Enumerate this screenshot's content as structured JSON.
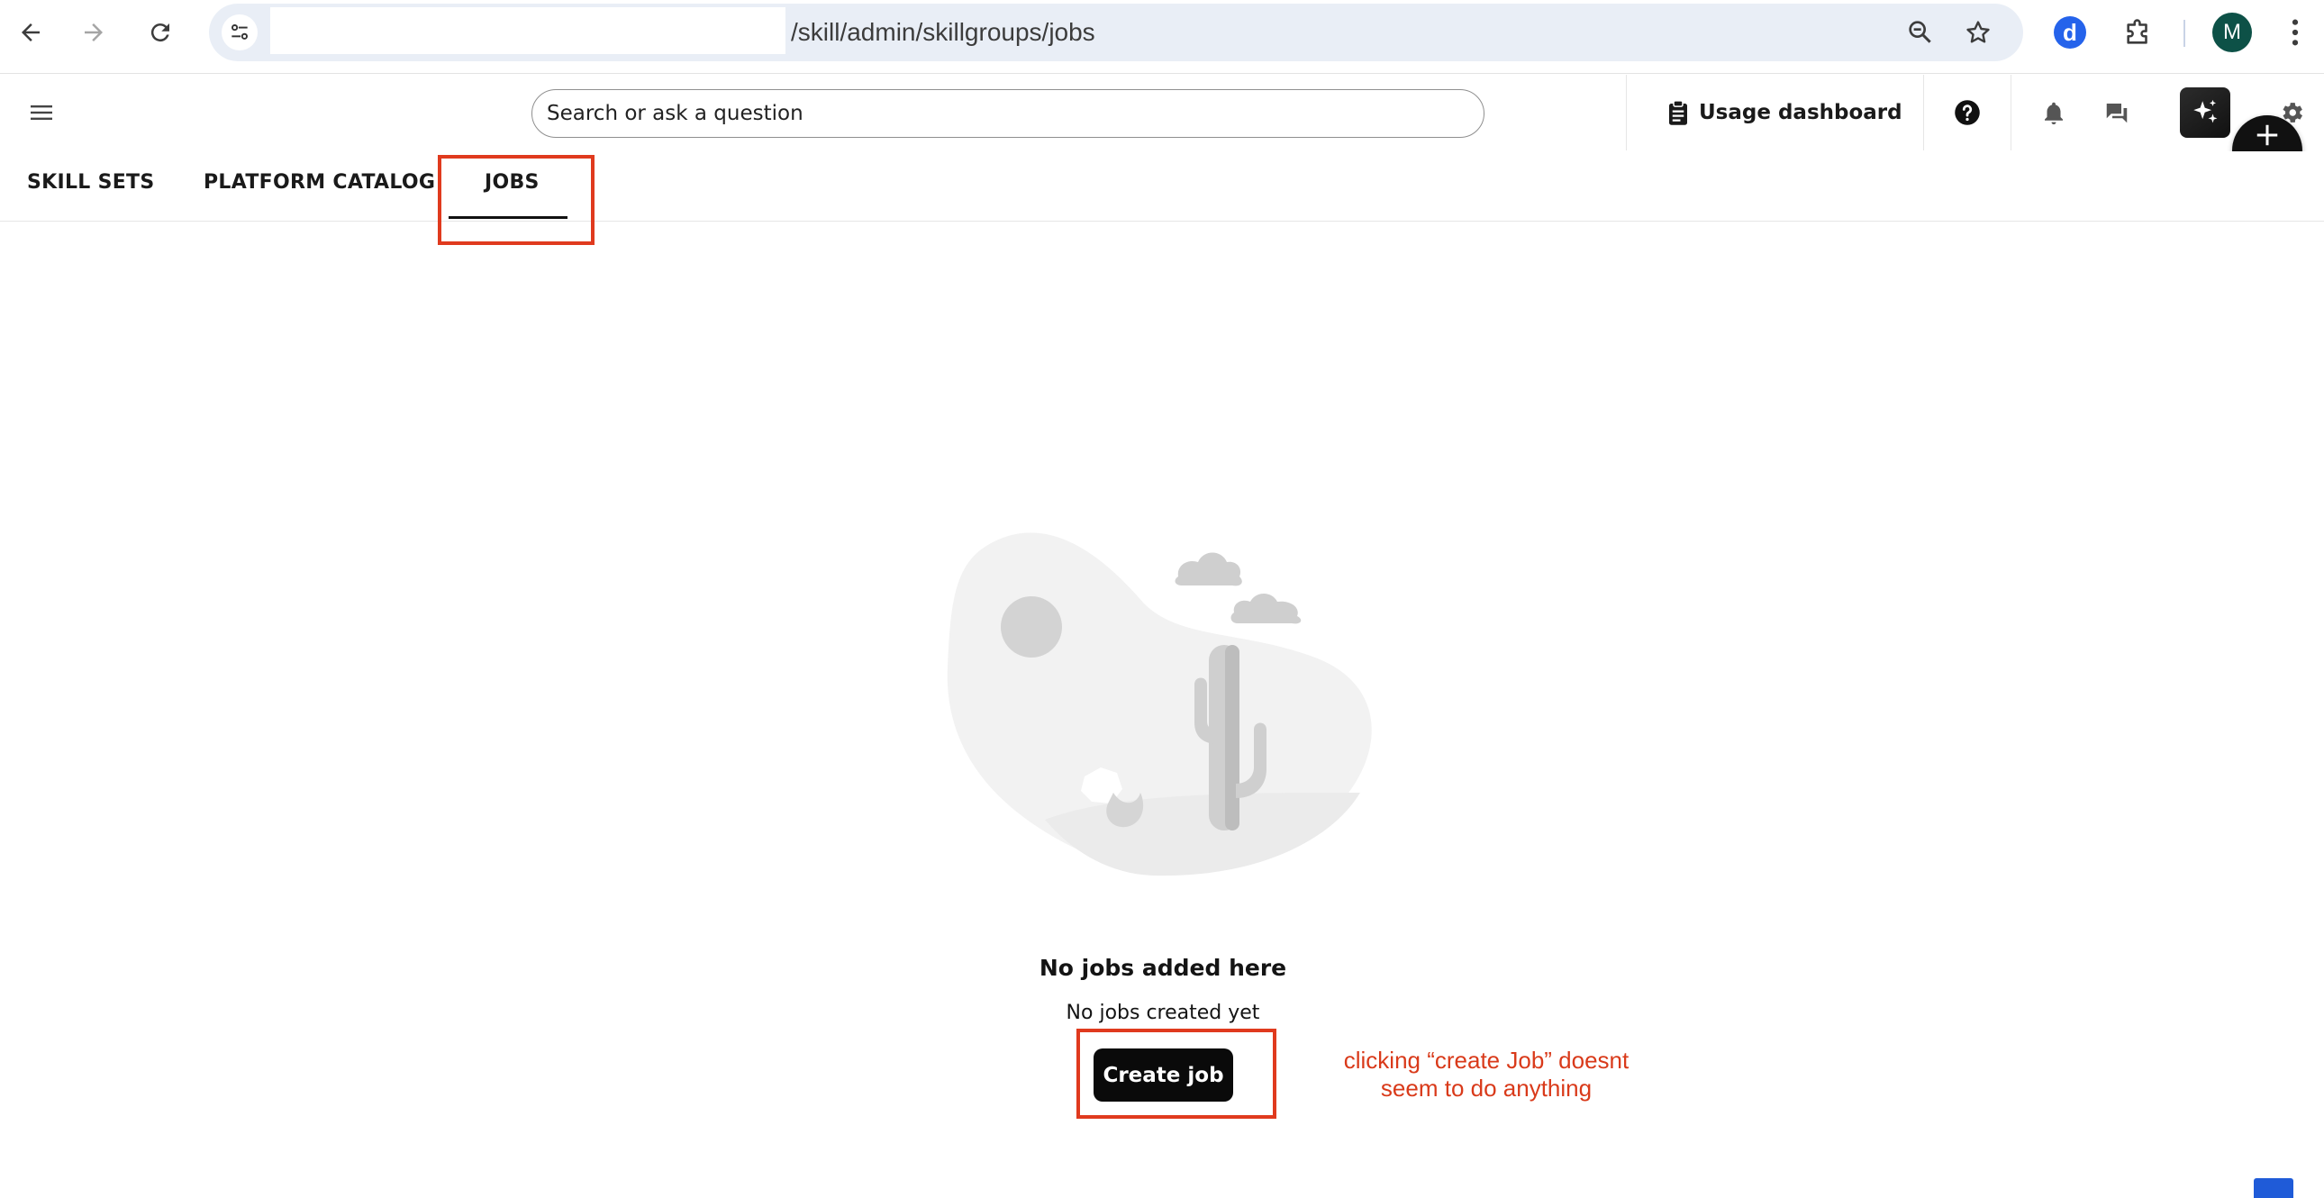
{
  "browser": {
    "url_path": "/skill/admin/skillgroups/jobs",
    "profile_initial": "M",
    "extension_letter": "d",
    "icons": [
      "back-arrow-icon",
      "forward-arrow-icon",
      "reload-icon",
      "site-settings-icon",
      "zoom-icon",
      "bookmark-star-icon",
      "puzzle-extension-icon",
      "kebab-menu-icon"
    ]
  },
  "header": {
    "search_placeholder": "Search or ask a question",
    "usage_dashboard_label": "Usage dashboard",
    "icons": [
      "hamburger-menu-icon",
      "clipboard-icon",
      "help-icon",
      "bell-icon",
      "chat-icon",
      "sparkle-icon",
      "gear-icon",
      "plus-icon"
    ]
  },
  "tabs": [
    {
      "label": "SKILL SETS",
      "active": false
    },
    {
      "label": "PLATFORM CATALOG",
      "active": false
    },
    {
      "label": "JOBS",
      "active": true
    }
  ],
  "empty_state": {
    "title": "No jobs added here",
    "subtitle": "No jobs created yet",
    "button_label": "Create job"
  },
  "annotation": {
    "note": "clicking “create Job” doesnt seem to do anything",
    "color": "#e03a1e"
  },
  "colors": {
    "omnibox_bg": "#e9eef6",
    "profile_bg": "#0d5147",
    "extension_bg": "#2563eb",
    "primary_button": "#0a0a0a",
    "annotation": "#e03a1e"
  }
}
